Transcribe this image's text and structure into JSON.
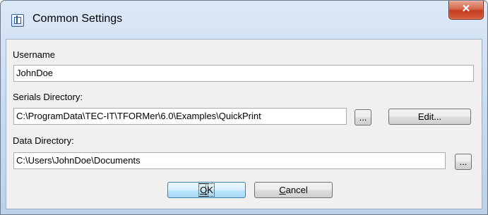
{
  "window": {
    "title": "Common Settings",
    "close_glyph": "✕",
    "app_icon": "settings-window-icon"
  },
  "username": {
    "label": "Username",
    "value": "JohnDoe"
  },
  "serials_directory": {
    "label": "Serials Directory:",
    "value": "C:\\ProgramData\\TEC-IT\\TFORMer\\6.0\\Examples\\QuickPrint",
    "browse_label": "...",
    "edit_label": "Edit..."
  },
  "data_directory": {
    "label": "Data Directory:",
    "value": "C:\\Users\\JohnDoe\\Documents",
    "browse_label": "..."
  },
  "buttons": {
    "ok": {
      "mnemonic": "O",
      "rest": "K"
    },
    "cancel": {
      "mnemonic": "C",
      "rest": "ancel"
    }
  },
  "colors": {
    "close_button": "#c3391b",
    "default_button_border": "#3c7fb1"
  }
}
